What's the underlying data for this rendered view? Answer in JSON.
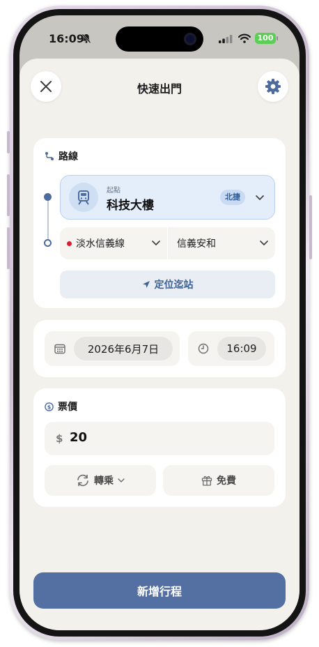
{
  "status_bar": {
    "time": "16:09",
    "battery": "100"
  },
  "header": {
    "title": "快速出門",
    "close_icon": "close-icon",
    "settings_icon": "gear-icon"
  },
  "route": {
    "section_label": "路線",
    "origin": {
      "caption": "起點",
      "name": "科技大樓",
      "system_badge": "北捷"
    },
    "line": "淡水信義線",
    "line_color": "#d32030",
    "station": "信義安和",
    "locate_button": "定位迄站"
  },
  "datetime": {
    "date": "2026年6月7日",
    "time": "16:09"
  },
  "fare": {
    "section_label": "票價",
    "currency": "$",
    "value": "20",
    "transfer_button": "轉乘",
    "free_button": "免費"
  },
  "actions": {
    "add_trip": "新增行程"
  },
  "colors": {
    "accent": "#5470a2",
    "sheet_bg": "#f3f1eb",
    "origin_bg": "#e4eefb"
  }
}
